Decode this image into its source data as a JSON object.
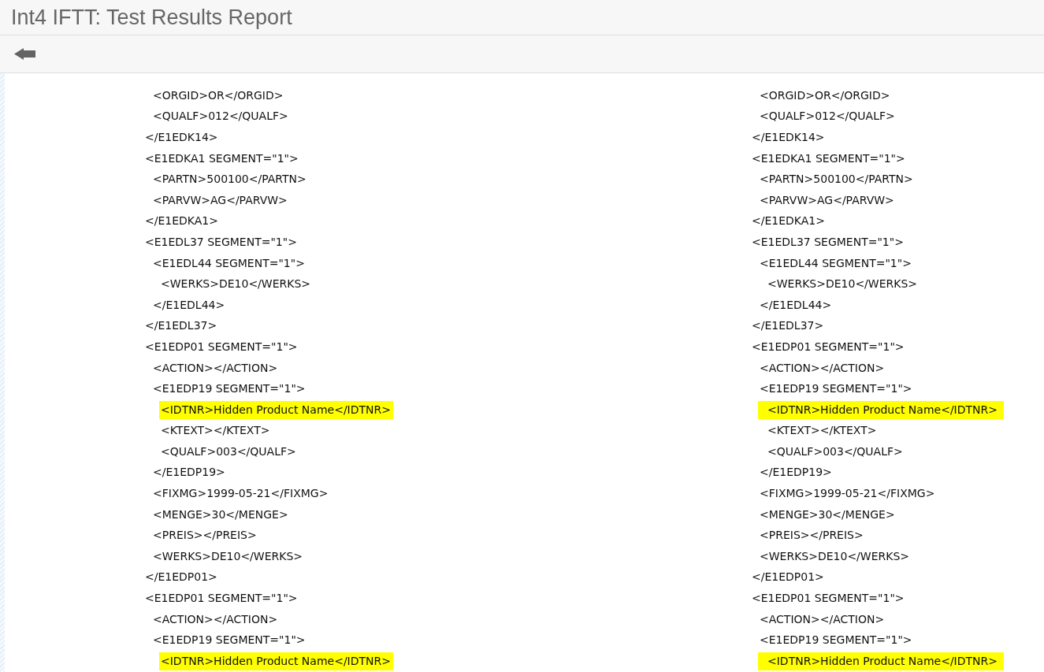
{
  "header": {
    "title": "Int4 IFTT: Test Results Report"
  },
  "panes": [
    {
      "lines": [
        {
          "children": [
            {
              "text": "<ORGID>OR</ORGID>",
              "highlighted": false
            },
            {
              "text": "<QUALF>012</QUALF>",
              "highlighted": false
            }
          ]
        },
        {
          "text": "</E1EDK14>",
          "highlighted": false
        },
        {
          "text": "<E1EDKA1 SEGMENT=\"1\">",
          "highlighted": false,
          "children": [
            {
              "text": "<PARTN>500100</PARTN>",
              "highlighted": false
            },
            {
              "text": "<PARVW>AG</PARVW>",
              "highlighted": false
            }
          ]
        },
        {
          "text": "</E1EDKA1>",
          "highlighted": false
        },
        {
          "text": "<E1EDL37 SEGMENT=\"1\">",
          "highlighted": false,
          "children": [
            {
              "text": "<E1EDL44 SEGMENT=\"1\">",
              "highlighted": false,
              "children": [
                {
                  "text": "<WERKS>DE10</WERKS>",
                  "highlighted": false
                }
              ]
            },
            {
              "text": "</E1EDL44>",
              "highlighted": false
            }
          ]
        },
        {
          "text": "</E1EDL37>",
          "highlighted": false
        },
        {
          "text": "<E1EDP01 SEGMENT=\"1\">",
          "highlighted": false,
          "children": [
            {
              "text": "<ACTION></ACTION>",
              "highlighted": false
            },
            {
              "text": "<E1EDP19 SEGMENT=\"1\">",
              "highlighted": false,
              "children": [
                {
                  "text": "<IDTNR>Hidden Product Name</IDTNR>",
                  "highlighted": true
                },
                {
                  "text": "<KTEXT></KTEXT>",
                  "highlighted": false
                },
                {
                  "text": "<QUALF>003</QUALF>",
                  "highlighted": false
                }
              ]
            },
            {
              "text": "</E1EDP19>",
              "highlighted": false
            },
            {
              "text": "<FIXMG>1999-05-21</FIXMG>",
              "highlighted": false
            },
            {
              "text": "<MENGE>30</MENGE>",
              "highlighted": false
            },
            {
              "text": "<PREIS></PREIS>",
              "highlighted": false
            },
            {
              "text": "<WERKS>DE10</WERKS>",
              "highlighted": false
            }
          ]
        },
        {
          "text": "</E1EDP01>",
          "highlighted": false
        },
        {
          "text": "<E1EDP01 SEGMENT=\"1\">",
          "highlighted": false,
          "children": [
            {
              "text": "<ACTION></ACTION>",
              "highlighted": false
            },
            {
              "text": "<E1EDP19 SEGMENT=\"1\">",
              "highlighted": false,
              "children": [
                {
                  "text": "<IDTNR>Hidden Product Name</IDTNR>",
                  "highlighted": true
                }
              ]
            }
          ]
        }
      ]
    },
    {
      "lines": [
        {
          "children": [
            {
              "text": "<ORGID>OR</ORGID>",
              "highlighted": false
            },
            {
              "text": "<QUALF>012</QUALF>",
              "highlighted": false
            }
          ]
        },
        {
          "text": "</E1EDK14>",
          "highlighted": false
        },
        {
          "text": "<E1EDKA1 SEGMENT=\"1\">",
          "highlighted": false,
          "children": [
            {
              "text": "<PARTN>500100</PARTN>",
              "highlighted": false
            },
            {
              "text": "<PARVW>AG</PARVW>",
              "highlighted": false
            }
          ]
        },
        {
          "text": "</E1EDKA1>",
          "highlighted": false
        },
        {
          "text": "<E1EDL37 SEGMENT=\"1\">",
          "highlighted": false,
          "children": [
            {
              "text": "<E1EDL44 SEGMENT=\"1\">",
              "highlighted": false,
              "children": [
                {
                  "text": "<WERKS>DE10</WERKS>",
                  "highlighted": false
                }
              ]
            },
            {
              "text": "</E1EDL44>",
              "highlighted": false
            }
          ]
        },
        {
          "text": "</E1EDL37>",
          "highlighted": false
        },
        {
          "text": "<E1EDP01 SEGMENT=\"1\">",
          "highlighted": false,
          "children": [
            {
              "text": "<ACTION></ACTION>",
              "highlighted": false
            },
            {
              "text": "<E1EDP19 SEGMENT=\"1\">",
              "highlighted": false,
              "children": [
                {
                  "text": "<IDTNR>Hidden Product Name</IDTNR>",
                  "highlighted": true
                },
                {
                  "text": "<KTEXT></KTEXT>",
                  "highlighted": false
                },
                {
                  "text": "<QUALF>003</QUALF>",
                  "highlighted": false
                }
              ]
            },
            {
              "text": "</E1EDP19>",
              "highlighted": false
            },
            {
              "text": "<FIXMG>1999-05-21</FIXMG>",
              "highlighted": false
            },
            {
              "text": "<MENGE>30</MENGE>",
              "highlighted": false
            },
            {
              "text": "<PREIS></PREIS>",
              "highlighted": false
            },
            {
              "text": "<WERKS>DE10</WERKS>",
              "highlighted": false
            }
          ]
        },
        {
          "text": "</E1EDP01>",
          "highlighted": false
        },
        {
          "text": "<E1EDP01 SEGMENT=\"1\">",
          "highlighted": false,
          "children": [
            {
              "text": "<ACTION></ACTION>",
              "highlighted": false
            },
            {
              "text": "<E1EDP19 SEGMENT=\"1\">",
              "highlighted": false,
              "children": [
                {
                  "text": "<IDTNR>Hidden Product Name</IDTNR>",
                  "highlighted": true
                }
              ]
            }
          ]
        }
      ]
    }
  ]
}
